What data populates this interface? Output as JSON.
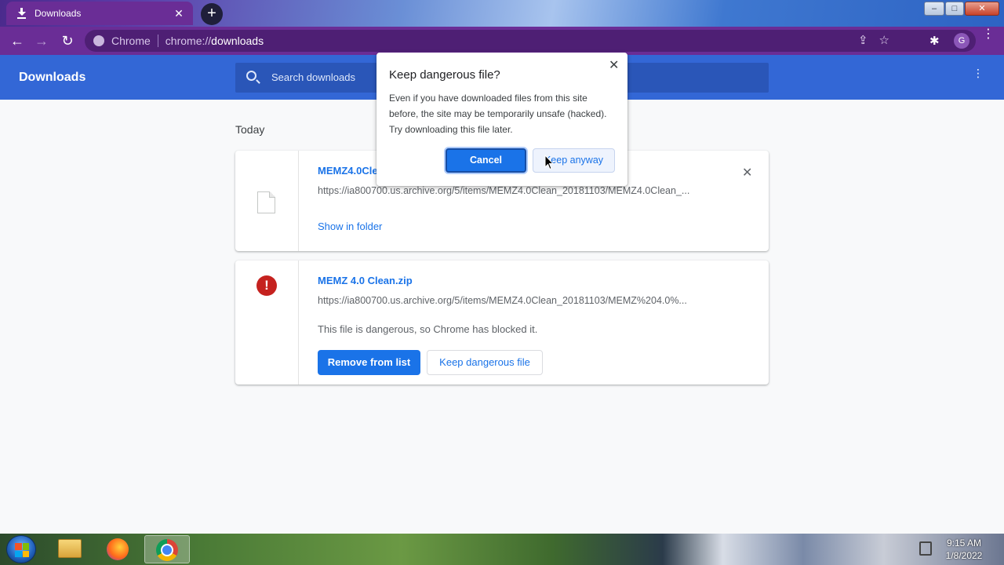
{
  "tab": {
    "title": "Downloads",
    "close": "✕"
  },
  "newtab": {
    "label": "+"
  },
  "window_controls": {
    "minimize": "–",
    "maximize": "□",
    "close": "✕"
  },
  "toolbar": {
    "back": "←",
    "forward": "→",
    "reload": "↻",
    "site_name": "Chrome",
    "url_scheme": "chrome://",
    "url_host": "downloads",
    "share": "⇪",
    "bookmark": "☆",
    "extensions": "✱",
    "profile_initial": "G",
    "menu": "⋮"
  },
  "header": {
    "title": "Downloads",
    "search_placeholder": "Search downloads",
    "menu": "⋮"
  },
  "section": {
    "date": "Today"
  },
  "downloads": [
    {
      "filename": "MEMZ4.0Cle",
      "url": "https://ia800700.us.archive.org/5/items/MEMZ4.0Clean_20181103/MEMZ4.0Clean_...",
      "action": "Show in folder",
      "close": "✕"
    },
    {
      "filename": "MEMZ 4.0 Clean.zip",
      "url": "https://ia800700.us.archive.org/5/items/MEMZ4.0Clean_20181103/MEMZ%204.0%...",
      "warning": "This file is dangerous, so Chrome has blocked it.",
      "remove_label": "Remove from list",
      "keep_label": "Keep dangerous file",
      "danger_glyph": "!"
    }
  ],
  "dialog": {
    "title": "Keep dangerous file?",
    "close": "✕",
    "body": "Even if you have downloaded files from this site before, the site may be temporarily unsafe (hacked). Try downloading this file later.",
    "cancel_label": "Cancel",
    "keep_label": "Keep anyway"
  },
  "taskbar": {
    "clock_time": "9:15 AM",
    "clock_date": "1/8/2022"
  },
  "colors": {
    "chrome_purple": "#6a2d96",
    "header_blue": "#3367d6",
    "link_blue": "#1a73e8",
    "danger_red": "#c5221f"
  },
  "icons": [
    "download-icon",
    "search-icon",
    "file-icon",
    "danger-icon",
    "close-icon",
    "kebab-menu-icon",
    "windows-start-icon",
    "folder-icon",
    "firefox-icon",
    "chrome-icon"
  ]
}
